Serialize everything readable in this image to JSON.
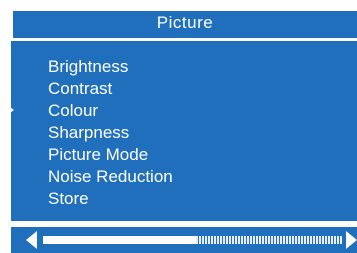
{
  "menu": {
    "title": "Picture",
    "items": [
      {
        "label": "Brightness"
      },
      {
        "label": "Contrast"
      },
      {
        "label": "Colour"
      },
      {
        "label": "Sharpness"
      },
      {
        "label": "Picture Mode"
      },
      {
        "label": "Noise Reduction"
      },
      {
        "label": "Store"
      }
    ],
    "selected_index": 2
  },
  "slider": {
    "value_fraction": 0.51
  },
  "colors": {
    "panel": "#1f6fbd",
    "text": "#ffffff",
    "background": "#ffffff"
  },
  "icons": {
    "selection_pointer": "triangle-right",
    "decrease": "triangle-left",
    "increase": "triangle-right"
  }
}
